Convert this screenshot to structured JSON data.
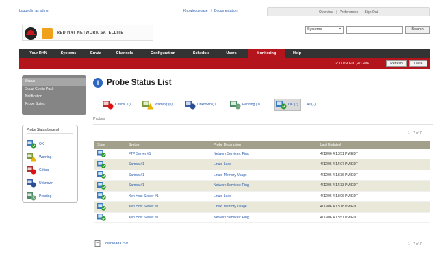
{
  "top": {
    "user_link": "Logged in as admin",
    "doc_links": [
      "Knowledgebase",
      "Documentation"
    ],
    "account_links": [
      "Overview",
      "Preferences",
      "Sign Out"
    ]
  },
  "brand": {
    "logo_text": "RED HAT NETWORK SATELLITE",
    "accent": "#b4141b",
    "nav_bg": "#333333"
  },
  "search": {
    "scope": "Systems",
    "value": "",
    "button": "Search"
  },
  "nav": {
    "tabs": [
      "Your RHN",
      "Systems",
      "Errata",
      "Channels",
      "Configuration",
      "Schedule",
      "Users",
      "Monitoring",
      "Help"
    ],
    "active": "Monitoring"
  },
  "subbar": {
    "status": "2:17 PM EDT, 4/12/06",
    "buttons": [
      "Refresh",
      "Close"
    ]
  },
  "sidebar": {
    "items": [
      "Status",
      "Scout Config Push",
      "Notification",
      "Probe Suites"
    ],
    "selected": "Status"
  },
  "legend": {
    "title": "Probe Status Legend",
    "items": [
      "OK",
      "Warning",
      "Critical",
      "Unknown",
      "Pending"
    ]
  },
  "page": {
    "title": "Probe Status List",
    "title_icon": "i",
    "section_label": "Probes",
    "pager_top": "1 - 7 of 7",
    "pager_bottom": "1 - 7 of 7",
    "csv_label": "Download CSV"
  },
  "filters": [
    {
      "label": "Critical (0)",
      "icon": "critical-icon"
    },
    {
      "label": "Warning (0)",
      "icon": "warning-icon"
    },
    {
      "label": "Unknown (0)",
      "icon": "unknown-icon"
    },
    {
      "label": "Pending (0)",
      "icon": "pending-icon"
    },
    {
      "label": "OK (7)",
      "icon": "ok-icon"
    },
    {
      "label": "All (7)",
      "icon": ""
    }
  ],
  "table": {
    "headers": [
      "State",
      "System",
      "Probe Description",
      "Last Updated"
    ],
    "rows": [
      {
        "system": "FTP Server #1",
        "description": "Network Services: Ping",
        "updated": "4/12/06 4:13:51 PM EDT"
      },
      {
        "system": "Samba #1",
        "description": "Linux: Load",
        "updated": "4/12/06 4:14:07 PM EDT"
      },
      {
        "system": "Samba #1",
        "description": "Linux: Memory Usage",
        "updated": "4/12/06 4:13:36 PM EDT"
      },
      {
        "system": "Samba #1",
        "description": "Network Services: Ping",
        "updated": "4/12/06 4:14:33 PM EDT"
      },
      {
        "system": "Xen Host Server #1",
        "description": "Linux: Load",
        "updated": "4/12/06 4:13:06 PM EDT"
      },
      {
        "system": "Xen Host Server #1",
        "description": "Linux: Memory Usage",
        "updated": "4/12/06 4:13:18 PM EDT"
      },
      {
        "system": "Xen Host Server #1",
        "description": "Network Services: Ping",
        "updated": "4/12/06 4:13:51 PM EDT"
      }
    ]
  }
}
